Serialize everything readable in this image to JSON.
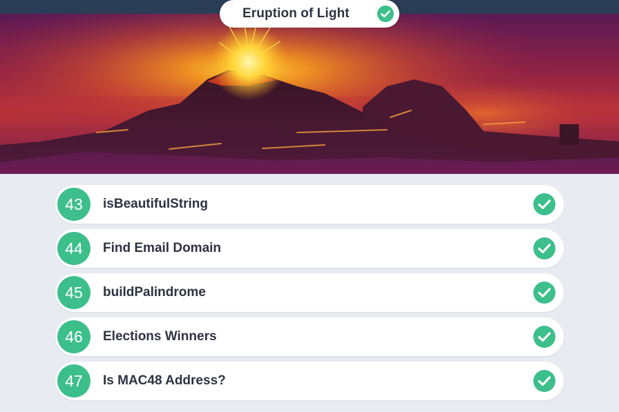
{
  "header": {
    "title": "Eruption of Light",
    "completed_icon": "check-circle-icon",
    "banner_image": "volcano-eruption-illustration"
  },
  "tasks": [
    {
      "number": "43",
      "label": "isBeautifulString",
      "completed": true,
      "status_icon": "check-circle-icon"
    },
    {
      "number": "44",
      "label": "Find Email Domain",
      "completed": true,
      "status_icon": "check-circle-icon"
    },
    {
      "number": "45",
      "label": "buildPalindrome",
      "completed": true,
      "status_icon": "check-circle-icon"
    },
    {
      "number": "46",
      "label": "Elections Winners",
      "completed": true,
      "status_icon": "check-circle-icon"
    },
    {
      "number": "47",
      "label": "Is MAC48 Address?",
      "completed": true,
      "status_icon": "check-circle-icon"
    }
  ],
  "colors": {
    "accent": "#3dbf8c",
    "page_background": "#e8ebf1",
    "header_strip": "#2b3d56",
    "text": "#2c3440"
  }
}
